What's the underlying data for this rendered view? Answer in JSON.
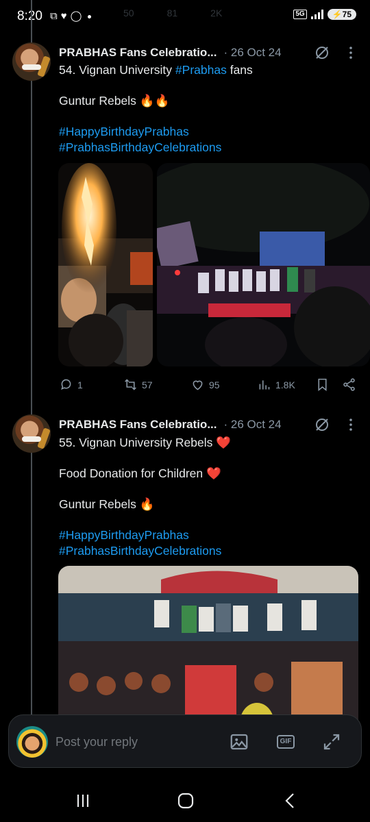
{
  "status_bar": {
    "time": "8:20",
    "network": "5G",
    "battery": "75",
    "ghost_counts": [
      "50",
      "81",
      "2K"
    ]
  },
  "tweets": [
    {
      "author": "PRABHAS Fans Celebratio...",
      "date": "· 26 Oct 24",
      "line1_prefix": "54. Vignan University ",
      "line1_tag": "#Prabhas",
      "line1_suffix": " fans",
      "line2": "Guntur Rebels 🔥🔥",
      "hashtag1": "#HappyBirthdayPrabhas",
      "hashtag2": "#PrabhasBirthdayCelebrations",
      "replies": "1",
      "reposts": "57",
      "likes": "95",
      "views": "1.8K"
    },
    {
      "author": "PRABHAS Fans Celebratio...",
      "date": "· 26 Oct 24",
      "line1": "55. Vignan University Rebels ❤️",
      "line2": "Food Donation for Children ❤️",
      "line3": "Guntur Rebels 🔥",
      "hashtag1": "#HappyBirthdayPrabhas",
      "hashtag2": "#PrabhasBirthdayCelebrations"
    }
  ],
  "reply_bar": {
    "placeholder": "Post your reply",
    "gif_label": "GIF"
  },
  "colors": {
    "background": "#000000",
    "text": "#e7e9ea",
    "muted": "#8b98a5",
    "link": "#1d9bf0"
  }
}
